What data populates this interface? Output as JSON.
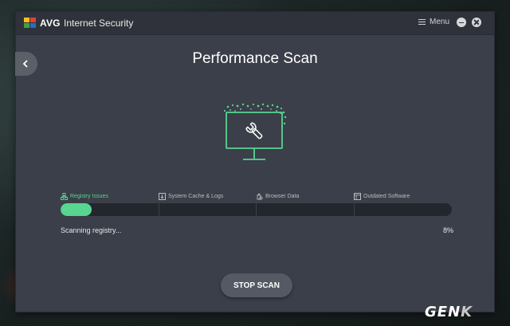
{
  "app": {
    "brand": "AVG",
    "product": "Internet Security"
  },
  "titlebar": {
    "menu_label": "Menu"
  },
  "page": {
    "title": "Performance Scan"
  },
  "scan": {
    "stages": [
      {
        "label": "Registry Issues",
        "active": true,
        "icon": "registry-icon"
      },
      {
        "label": "System Cache & Logs",
        "active": false,
        "icon": "cache-icon"
      },
      {
        "label": "Browser Data",
        "active": false,
        "icon": "browser-icon"
      },
      {
        "label": "Outdated Software",
        "active": false,
        "icon": "software-icon"
      }
    ],
    "progress": 0.08,
    "status": "Scanning registry...",
    "percent": "8%"
  },
  "actions": {
    "stop_label": "STOP SCAN"
  },
  "watermark": {
    "text_main": "GEN",
    "text_accent": "K"
  },
  "colors": {
    "accent": "#57d591",
    "window_bg": "#3b3f49",
    "titlebar_bg": "#2f323a"
  }
}
